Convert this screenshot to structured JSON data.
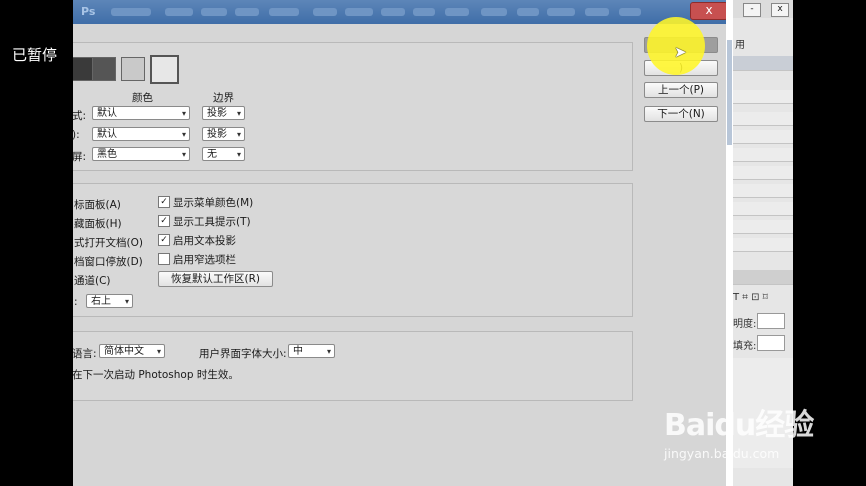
{
  "overlay": {
    "paused": "已暂停"
  },
  "titlebar": {
    "app": "Ps",
    "close": "x"
  },
  "side_panel": {
    "header": "用",
    "btn_a": "-",
    "btn_b": "x",
    "opacity_label": "明度:",
    "fill_label": "填充:",
    "layer_icons": "T  ⌗  ⊡  ⌑"
  },
  "dialog_buttons": {
    "ok": "",
    "cancel": ")",
    "prev": "上一个(P)",
    "next": "下一个(N)"
  },
  "appearance": {
    "col_color": "颜色",
    "col_border": "边界",
    "rows": [
      {
        "label": "式:",
        "color": "默认",
        "border": "投影"
      },
      {
        "label": "):",
        "color": "默认",
        "border": "投影"
      },
      {
        "label": "屏:",
        "color": "黑色",
        "border": "无"
      }
    ],
    "swatch_colors": [
      "#3a3a3a",
      "#555555",
      "#c9c9c9",
      "#e7e7e7"
    ]
  },
  "options": {
    "left_items": [
      "标面板(A)",
      "藏面板(H)",
      "式打开文档(O)",
      "档窗口停放(D)",
      "通道(C)"
    ],
    "right_items": [
      {
        "label": "显示菜单颜色(M)",
        "checked": true,
        "mark": "✓"
      },
      {
        "label": "显示工具提示(T)",
        "checked": true,
        "mark": "✓"
      },
      {
        "label": "启用文本投影",
        "checked": true,
        "mark": "✓"
      },
      {
        "label": "启用窄选项栏",
        "checked": false,
        "mark": ""
      }
    ],
    "restore_button": "恢复默认工作区(R)",
    "position_label": ":",
    "position_value": "右上"
  },
  "text_section": {
    "lang_label": "语言:",
    "lang_value": "简体中文",
    "font_size_label": "用户界面字体大小:",
    "font_size_value": "中",
    "note": "在下一次启动 Photoshop 时生效。"
  },
  "watermark": {
    "brand": "Baidu经验",
    "url": "jingyan.baidu.com"
  }
}
